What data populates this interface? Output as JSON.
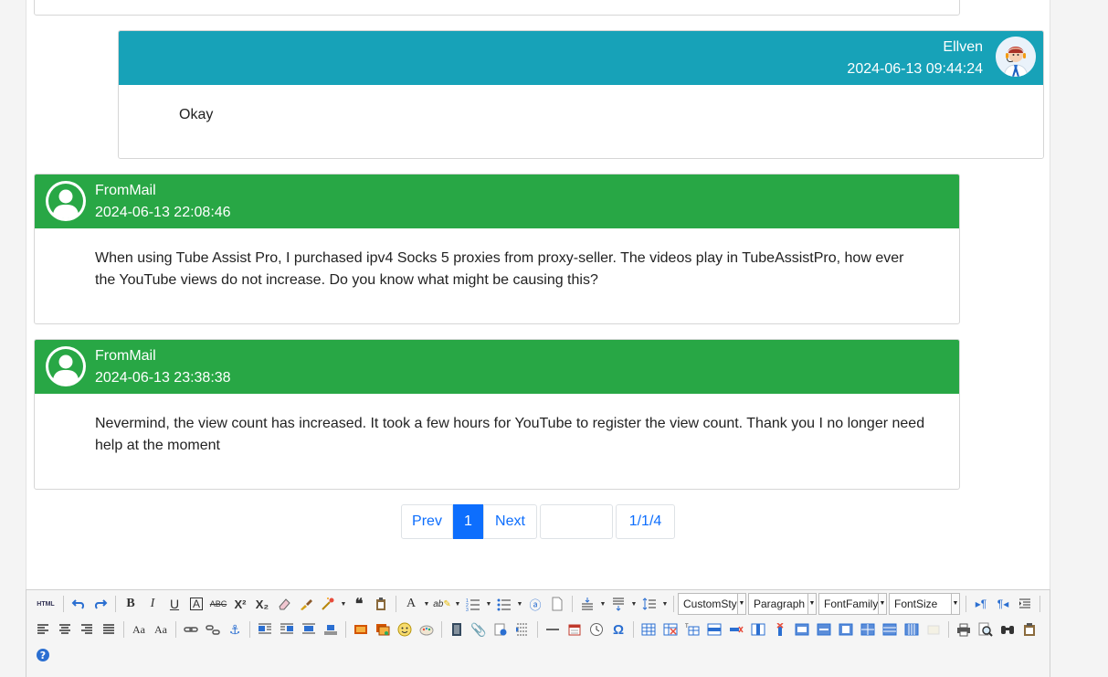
{
  "messages": [
    {
      "author": "Ellven",
      "timestamp": "2024-06-13 09:44:24",
      "body": "Okay"
    },
    {
      "author": "FromMail",
      "timestamp": "2024-06-13 22:08:46",
      "body": "When using Tube Assist Pro, I purchased ipv4 Socks 5 proxies from proxy-seller. The videos play in TubeAssistPro, how ever the YouTube views do not increase. Do you know what might be causing this?"
    },
    {
      "author": "FromMail",
      "timestamp": "2024-06-13 23:38:38",
      "body": "Nevermind, the view count has increased. It took a few hours for YouTube to register the view count. Thank you I no longer need help at the moment"
    }
  ],
  "pagination": {
    "prev_label": "Prev",
    "current_page": "1",
    "next_label": "Next",
    "page_input": "",
    "page_info": "1/1/4"
  },
  "editor": {
    "style_select": "CustomSty",
    "paragraph_select": "Paragraph",
    "font_family_select": "FontFamily",
    "font_size_select": "FontSize"
  },
  "colors": {
    "staff_header": "#17a2b8",
    "customer_header": "#28a745",
    "link": "#0d6efd"
  }
}
